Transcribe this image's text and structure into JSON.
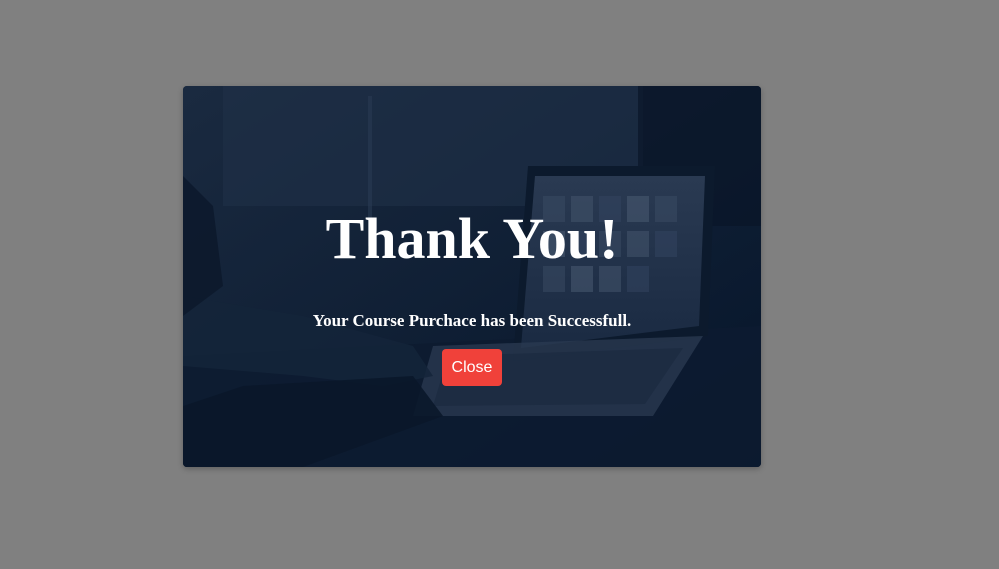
{
  "modal": {
    "title": "Thank You!",
    "message": "Your Course Purchace has been Successfull.",
    "close_label": "Close"
  },
  "colors": {
    "backdrop": "#808080",
    "modal_tint": "#0f1f35",
    "text": "#ffffff",
    "close_button": "#f0413a"
  },
  "icons": {
    "background_image": "laptop-photo"
  }
}
